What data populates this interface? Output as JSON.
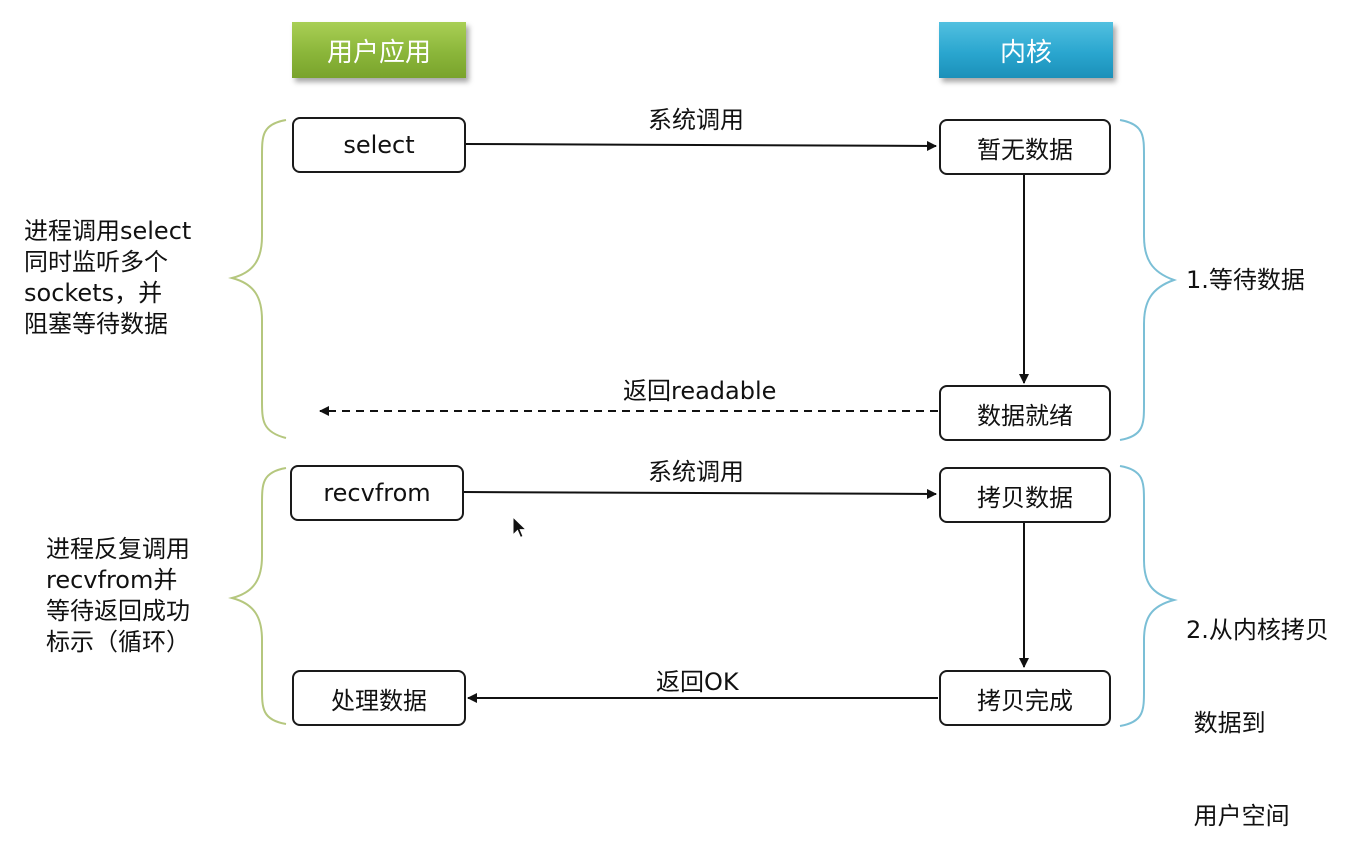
{
  "headers": {
    "user_app": "用户应用",
    "kernel": "内核"
  },
  "boxes": {
    "select": "select",
    "no_data": "暂无数据",
    "data_ready": "数据就绪",
    "recvfrom": "recvfrom",
    "copy_data": "拷贝数据",
    "process_data": "处理数据",
    "copy_done": "拷贝完成"
  },
  "arrow_labels": {
    "syscall_1": "系统调用",
    "return_readable": "返回readable",
    "syscall_2": "系统调用",
    "return_ok": "返回OK"
  },
  "left_notes": {
    "phase1": [
      "进程调用select",
      "同时监听多个",
      "sockets，并",
      "阻塞等待数据"
    ],
    "phase2": [
      "进程反复调用",
      "recvfrom并",
      "等待返回成功",
      "标示（循环）"
    ]
  },
  "right_notes": {
    "phase1": [
      "1.等待数据"
    ],
    "phase2": [
      "2.从内核拷贝",
      " 数据到",
      " 用户空间"
    ]
  },
  "colors": {
    "user_header": "#8bb63a",
    "kernel_header": "#2aa6cf",
    "left_brace": "#b5c77e",
    "right_brace": "#7bbfd6"
  }
}
